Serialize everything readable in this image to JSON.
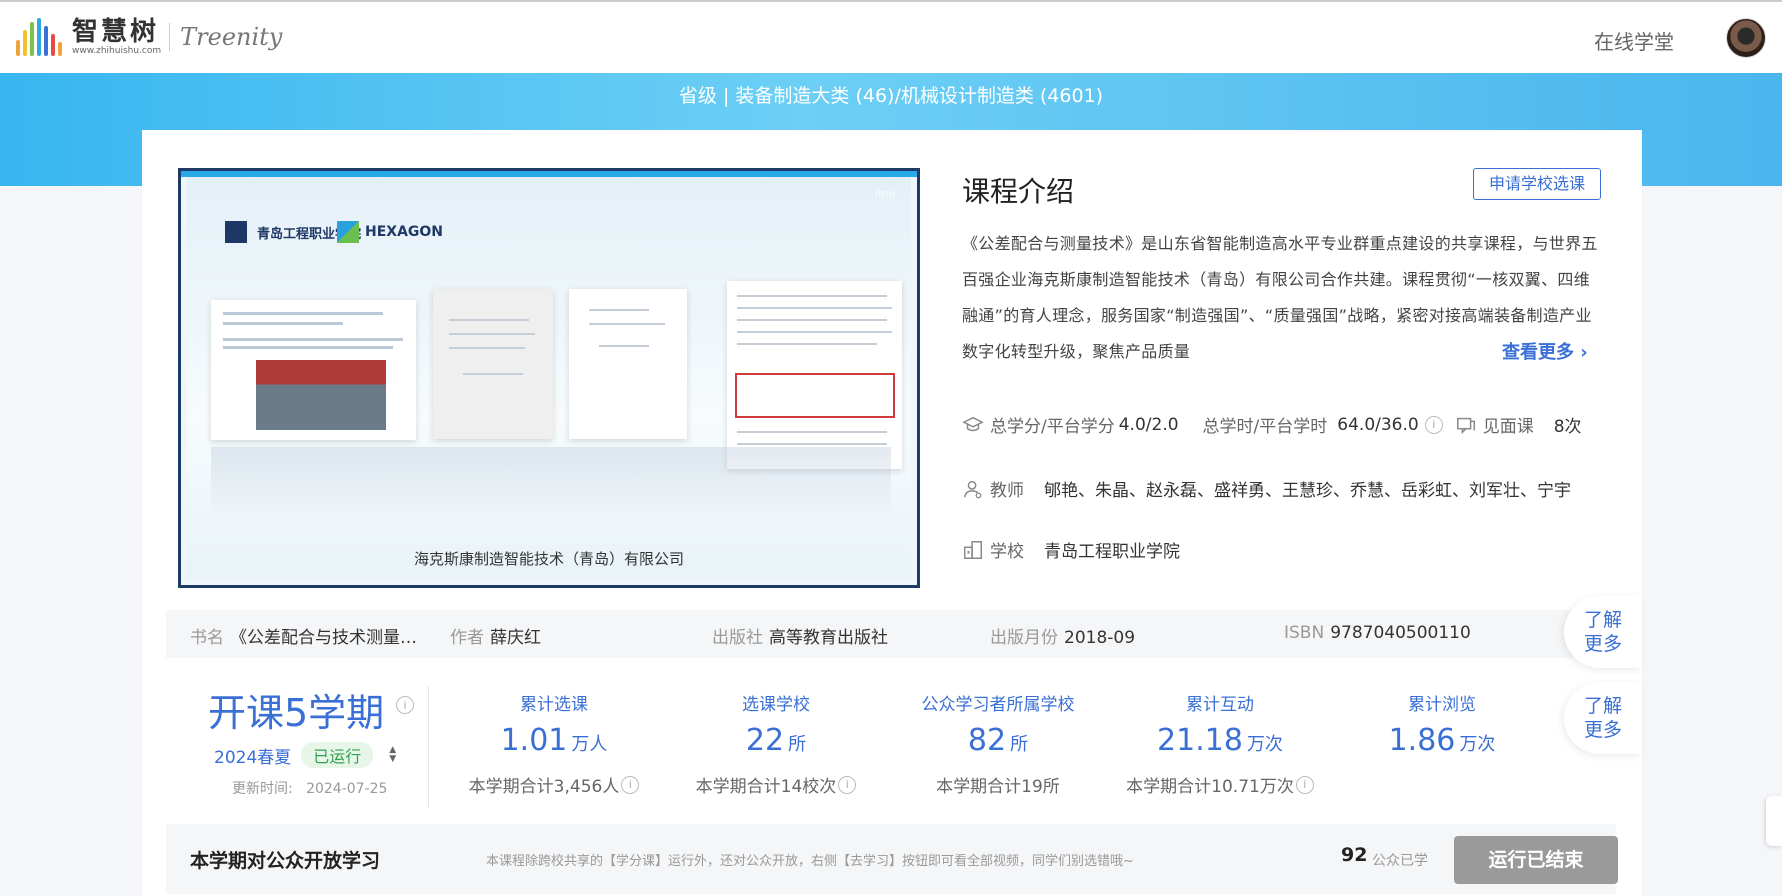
{
  "header": {
    "logo_cn": "智慧树",
    "logo_url": "www.zhihuishu.com",
    "logo_en": "Treenity",
    "nav_online": "在线学堂",
    "logo_bar_colors": [
      "#f2a23a",
      "#f2c12e",
      "#7cc14a",
      "#2fa8e0",
      "#3a6fd6",
      "#e34b4b",
      "#f2a23a"
    ]
  },
  "banner": {
    "text": "省级 | 装备制造大类 (46)/机械设计制造类 (4601)"
  },
  "video": {
    "school": "青岛工程职业学院",
    "partner": "HEXAGON",
    "caption": "海克斯康制造智能技术（青岛）有限公司",
    "watermark": "ilmi"
  },
  "intro": {
    "title": "课程介绍",
    "apply_button": "申请学校选课",
    "text": "《公差配合与测量技术》是山东省智能制造高水平专业群重点建设的共享课程，与世界五百强企业海克斯康制造智能技术（青岛）有限公司合作共建。课程贯彻“一核双翼、四维融通”的育人理念，服务国家“制造强国”、“质量强国”战略，紧密对接高端装备制造产业数字化转型升级，聚焦产品质量",
    "more": "查看更多",
    "credits_label": "总学分/平台学分",
    "credits_value": "4.0/2.0",
    "hours_label": "总学时/平台学时",
    "hours_value": "64.0/36.0",
    "meet_label": "见面课",
    "meet_value": "8次",
    "teacher_label": "教师",
    "teachers": "郇艳、朱晶、赵永磊、盛祥勇、王慧珍、乔慧、岳彩虹、刘军壮、宁宇",
    "school_label": "学校",
    "school": "青岛工程职业学院"
  },
  "book": {
    "name_label": "书名",
    "name": "《公差配合与技术测量…",
    "author_label": "作者",
    "author": "薛庆红",
    "publisher_label": "出版社",
    "publisher": "高等教育出版社",
    "date_label": "出版月份",
    "date": "2018-09",
    "isbn_label": "ISBN",
    "isbn": "9787040500110",
    "learn_more": "了解更多"
  },
  "term": {
    "title": "开课5学期",
    "current": "2024春夏",
    "status": "已运行",
    "update_label": "更新时间:",
    "update_time": "2024-07-25",
    "learn_more": "了解更多"
  },
  "stats": [
    {
      "label": "累计选课",
      "value": "1.01",
      "unit": "万人",
      "sub": "本学期合计3,456人",
      "info": true
    },
    {
      "label": "选课学校",
      "value": "22",
      "unit": "所",
      "sub": "本学期合计14校次",
      "info": true
    },
    {
      "label": "公众学习者所属学校",
      "value": "82",
      "unit": "所",
      "sub": "本学期合计19所",
      "info": false
    },
    {
      "label": "累计互动",
      "value": "21.18",
      "unit": "万次",
      "sub": "本学期合计10.71万次",
      "info": true
    },
    {
      "label": "累计浏览",
      "value": "1.86",
      "unit": "万次",
      "sub": "",
      "info": false
    }
  ],
  "open": {
    "title": "本学期对公众开放学习",
    "desc": "本课程除跨校共享的【学分课】运行外，还对公众开放，右侧【去学习】按钮即可看全部视频，同学们别选错哦~",
    "count": "92",
    "count_label": "公众已学",
    "button": "运行已结束"
  }
}
